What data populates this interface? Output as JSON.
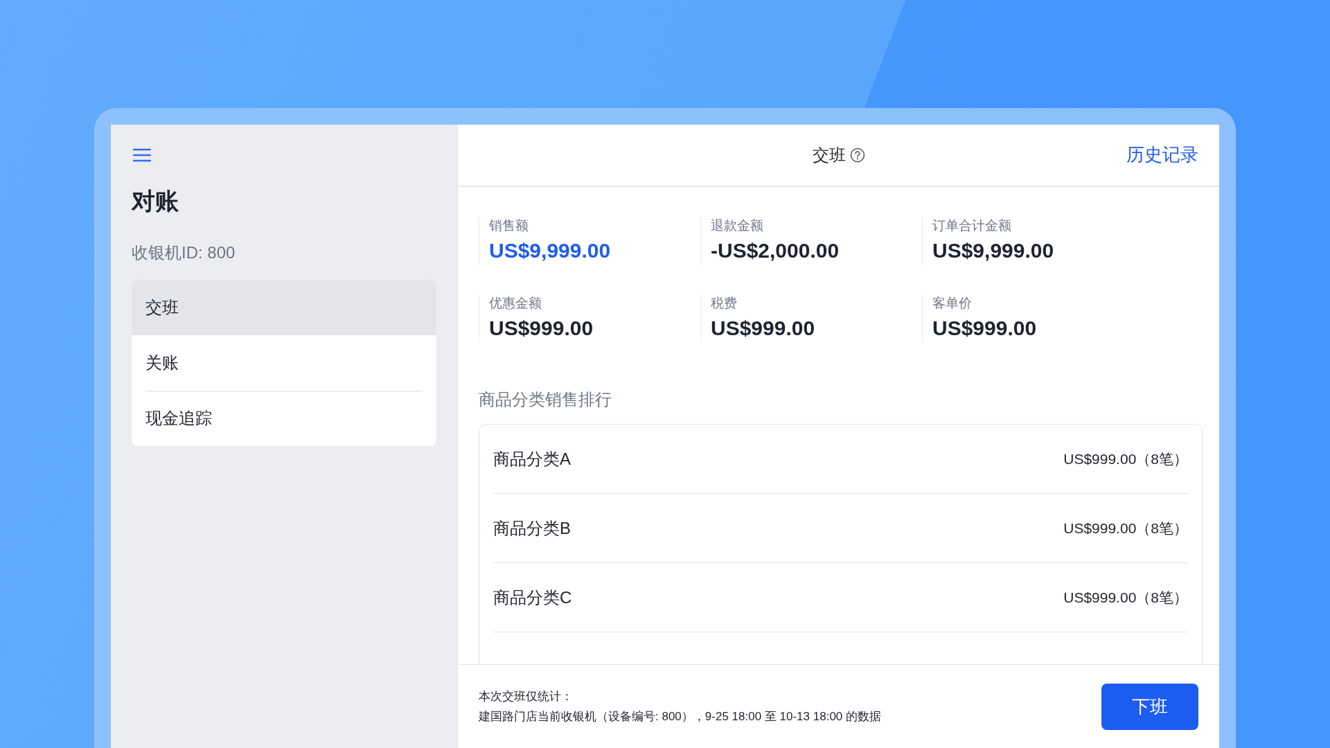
{
  "sidebar": {
    "title": "对账",
    "register_id": "收银机ID: 800",
    "items": [
      {
        "label": "交班",
        "selected": true
      },
      {
        "label": "关账",
        "selected": false
      },
      {
        "label": "现金追踪",
        "selected": false
      }
    ]
  },
  "header": {
    "title": "交班",
    "history_link": "历史记录"
  },
  "stats": [
    {
      "label": "销售额",
      "value": "US$9,999.00",
      "highlight": true
    },
    {
      "label": "退款金额",
      "value": "-US$2,000.00",
      "highlight": false
    },
    {
      "label": "订单合计金额",
      "value": "US$9,999.00",
      "highlight": false
    },
    {
      "label": "优惠金额",
      "value": "US$999.00",
      "highlight": false
    },
    {
      "label": "税费",
      "value": "US$999.00",
      "highlight": false
    },
    {
      "label": "客单价",
      "value": "US$999.00",
      "highlight": false
    }
  ],
  "section_title": "商品分类销售排行",
  "categories": [
    {
      "name": "商品分类A",
      "amount": "US$999.00（8笔）"
    },
    {
      "name": "商品分类B",
      "amount": "US$999.00（8笔）"
    },
    {
      "name": "商品分类C",
      "amount": "US$999.00（8笔）"
    }
  ],
  "footer": {
    "note_title": "本次交班仅统计：",
    "note": "建国路门店当前收银机（设备编号: 800），9-25 18:00 至 10-13 18:00 的数据",
    "button": "下班"
  }
}
